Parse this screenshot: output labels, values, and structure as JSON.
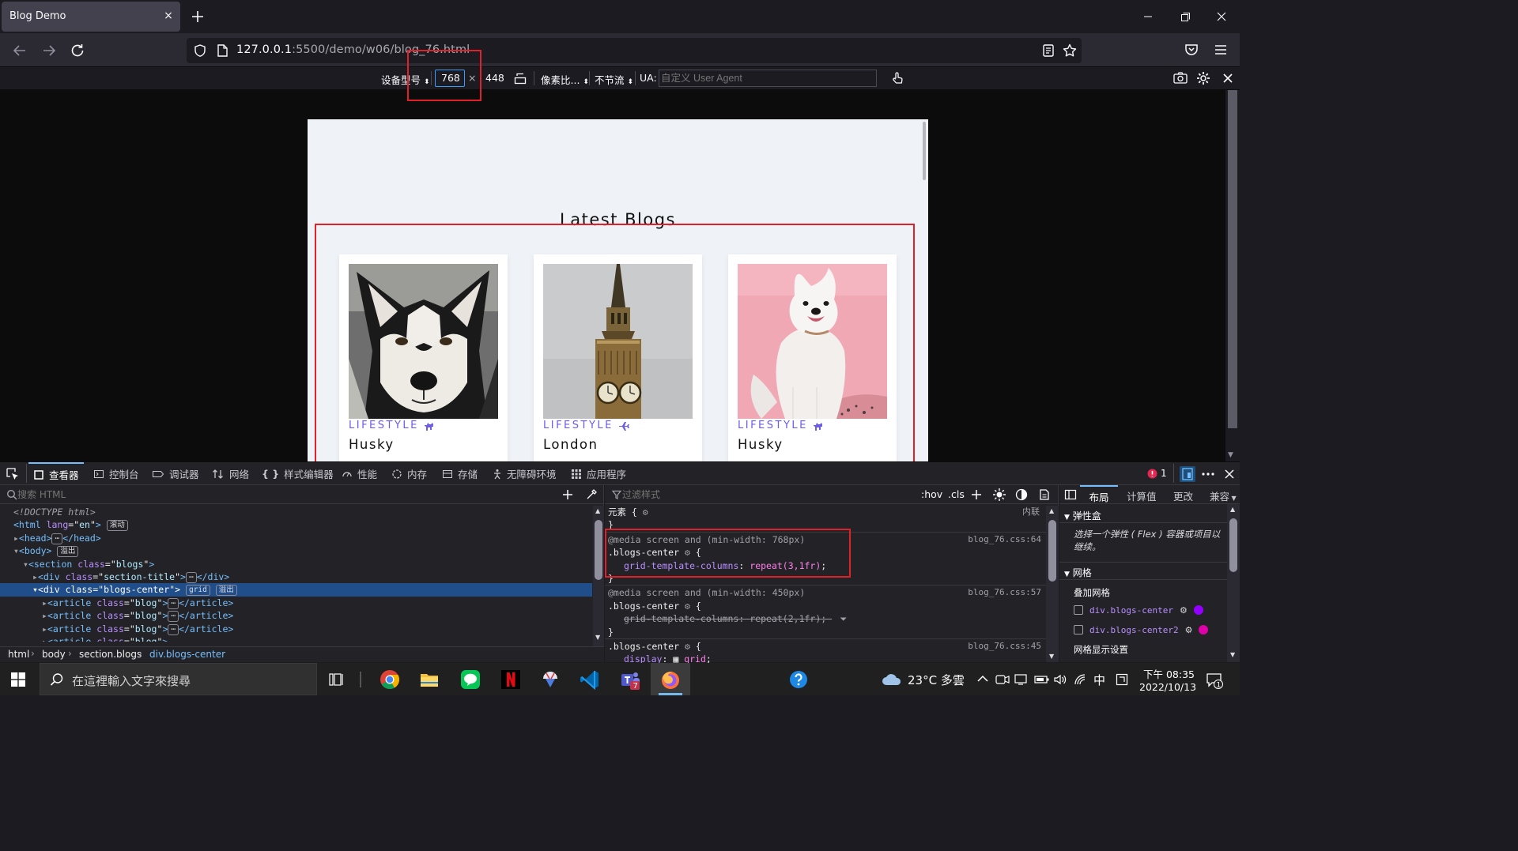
{
  "tab": {
    "title": "Blog Demo",
    "close_glyph": "×",
    "new_tab_glyph": "+"
  },
  "window": {
    "minimize": "minimize-icon",
    "restore": "restore-icon",
    "close": "close-icon"
  },
  "url": {
    "host": "127.0.0.1",
    "rest": ":5500/demo/w06/blog_76.html"
  },
  "rdm": {
    "device": "设备型号",
    "width": "768",
    "times": "×",
    "height": "448",
    "dpr": "像素比...",
    "throttle": "不节流",
    "ua_label": "UA:",
    "ua_placeholder": "自定义 User Agent"
  },
  "page": {
    "section_title": "Latest Blogs",
    "cards": [
      {
        "category": "LIFESTYLE",
        "title": "Husky"
      },
      {
        "category": "LIFESTYLE",
        "title": "London"
      },
      {
        "category": "LIFESTYLE",
        "title": "Husky"
      }
    ]
  },
  "devtools": {
    "tabs": [
      "查看器",
      "控制台",
      "调试器",
      "网络",
      "样式编辑器",
      "性能",
      "内存",
      "存储",
      "无障碍环境",
      "应用程序"
    ],
    "error_count": "1",
    "html_search_placeholder": "搜索 HTML",
    "styles_filter_placeholder": "过滤样式",
    "hov": ":hov",
    "cls": ".cls",
    "right_tabs": [
      "布局",
      "计算值",
      "更改",
      "兼容"
    ],
    "html_tree": {
      "doctype": "<!DOCTYPE html>",
      "badge_scroll": "滚动",
      "badge_overflow": "溢出",
      "badge_grid": "grid",
      "badge_ellipsis": "⋯",
      "section_class": "blogs",
      "section_title_class": "section-title",
      "blogs_center_class": "blogs-center",
      "article_class": "blog",
      "lang": "en"
    },
    "rules": {
      "element_selector": "元素 {",
      "inline": "内联",
      "r1_media": "@media screen and (min-width: 768px)",
      "r1_src": "blog_76.css:64",
      "r1_selector": ".blogs-center",
      "r1_prop": "grid-template-columns",
      "r1_val": "repeat(3,1fr)",
      "r2_media": "@media screen and (min-width: 450px)",
      "r2_src": "blog_76.css:57",
      "r2_selector": ".blogs-center",
      "r2_prop": "grid-template-columns",
      "r2_val": "repeat(2,1fr)",
      "r3_src": "blog_76.css:45",
      "r3_selector": ".blogs-center",
      "r3_prop": "display",
      "r3_val": "grid"
    },
    "layout": {
      "flexbox_header": "弹性盒",
      "flexbox_hint": "选择一个弹性 ( Flex ) 容器或项目以继续。",
      "grid_header": "网格",
      "overlay_header": "叠加网格",
      "grid_items": [
        "div.blogs-center",
        "div.blogs-center2"
      ],
      "grid_display_settings": "网格显示设置"
    },
    "breadcrumbs": [
      "html",
      "body",
      "section.blogs",
      "div.blogs-center"
    ]
  },
  "taskbar": {
    "search_placeholder": "在這裡輸入文字來搜尋",
    "weather": "23°C 多雲",
    "ime": "中",
    "time": "下午 08:35",
    "date": "2022/10/13",
    "teams_badge": "7",
    "notif_badge": "1"
  },
  "colors": {
    "accent": "#6c5ce7",
    "highlight": "#e0202b",
    "selection": "#204e8a"
  }
}
